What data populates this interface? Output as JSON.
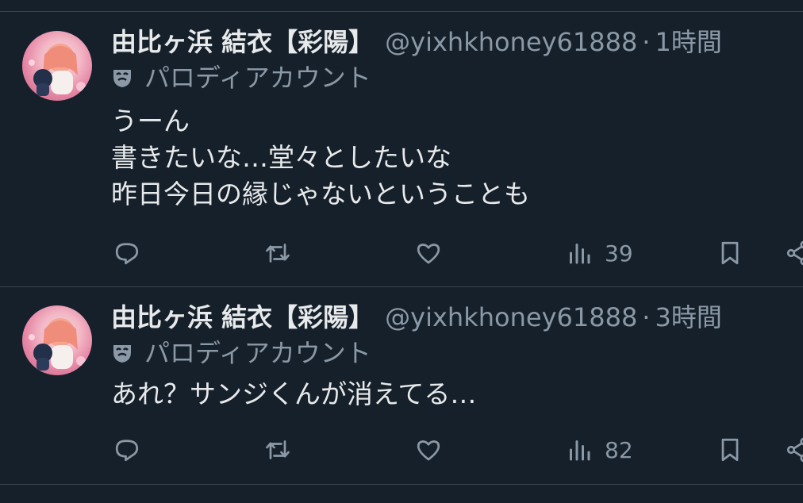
{
  "tweets": [
    {
      "display_name": "由比ヶ浜 結衣【彩陽】",
      "handle": "@yixhkhoney61888",
      "separator": "·",
      "time": "1時間",
      "parody_label": "パロディアカウント",
      "lines": [
        "うーん",
        "書きたいな…堂々としたいな",
        "昨日今日の縁じゃないということも"
      ],
      "views": "39"
    },
    {
      "display_name": "由比ヶ浜 結衣【彩陽】",
      "handle": "@yixhkhoney61888",
      "separator": "·",
      "time": "3時間",
      "parody_label": "パロディアカウント",
      "lines": [
        "あれ？サンジくんが消えてる…"
      ],
      "views": "82"
    }
  ],
  "icons": {
    "reply": "reply-icon",
    "retweet": "retweet-icon",
    "like": "heart-icon",
    "views": "views-icon",
    "bookmark": "bookmark-icon",
    "share": "share-icon",
    "parody": "mask-icon"
  },
  "colors": {
    "background": "#15202b",
    "text_primary": "#e7e9ea",
    "text_secondary": "#8b98a5",
    "divider": "#38444d"
  }
}
